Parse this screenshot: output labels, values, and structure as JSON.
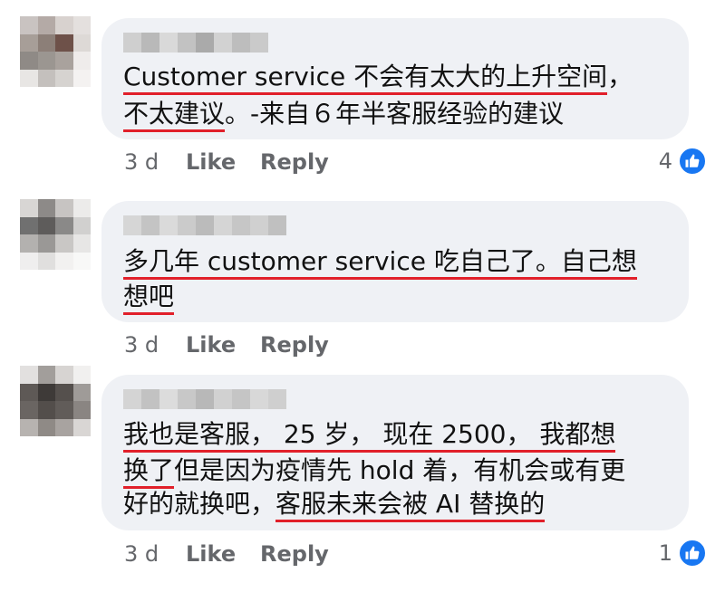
{
  "comments": [
    {
      "lines": [
        [
          {
            "t": "Customer service 不会有太大的上升空间",
            "u": true
          },
          {
            "t": "，",
            "u": false
          }
        ],
        [
          {
            "t": "不太建议",
            "u": true
          },
          {
            "t": "。-来自６年半客服经验的建议",
            "u": false
          }
        ]
      ],
      "time": "3 d",
      "like": "Like",
      "reply": "Reply",
      "reactions": "4"
    },
    {
      "lines": [
        [
          {
            "t": "多几年 customer service 吃自己了。自己想",
            "u": true
          }
        ],
        [
          {
            "t": "想吧",
            "u": true
          }
        ]
      ],
      "time": "3 d",
      "like": "Like",
      "reply": "Reply",
      "reactions": ""
    },
    {
      "lines": [
        [
          {
            "t": "我也是客服， 25 岁， 现在 2500， 我都想",
            "u": true
          }
        ],
        [
          {
            "t": "换了",
            "u": true
          },
          {
            "t": "但是因为疫情先 hold 着，有机会或有更",
            "u": false
          }
        ],
        [
          {
            "t": "好的就换吧，",
            "u": false
          },
          {
            "t": "客服未来会被 AI 替换的",
            "u": true
          }
        ]
      ],
      "time": "3 d",
      "like": "Like",
      "reply": "Reply",
      "reactions": "1"
    }
  ],
  "icons": {
    "reaction": "like-thumb-icon"
  },
  "colors": {
    "bubble": "#eff1f5",
    "underline": "#e1202a",
    "meta": "#65676b",
    "like_blue": "#1877f2"
  }
}
